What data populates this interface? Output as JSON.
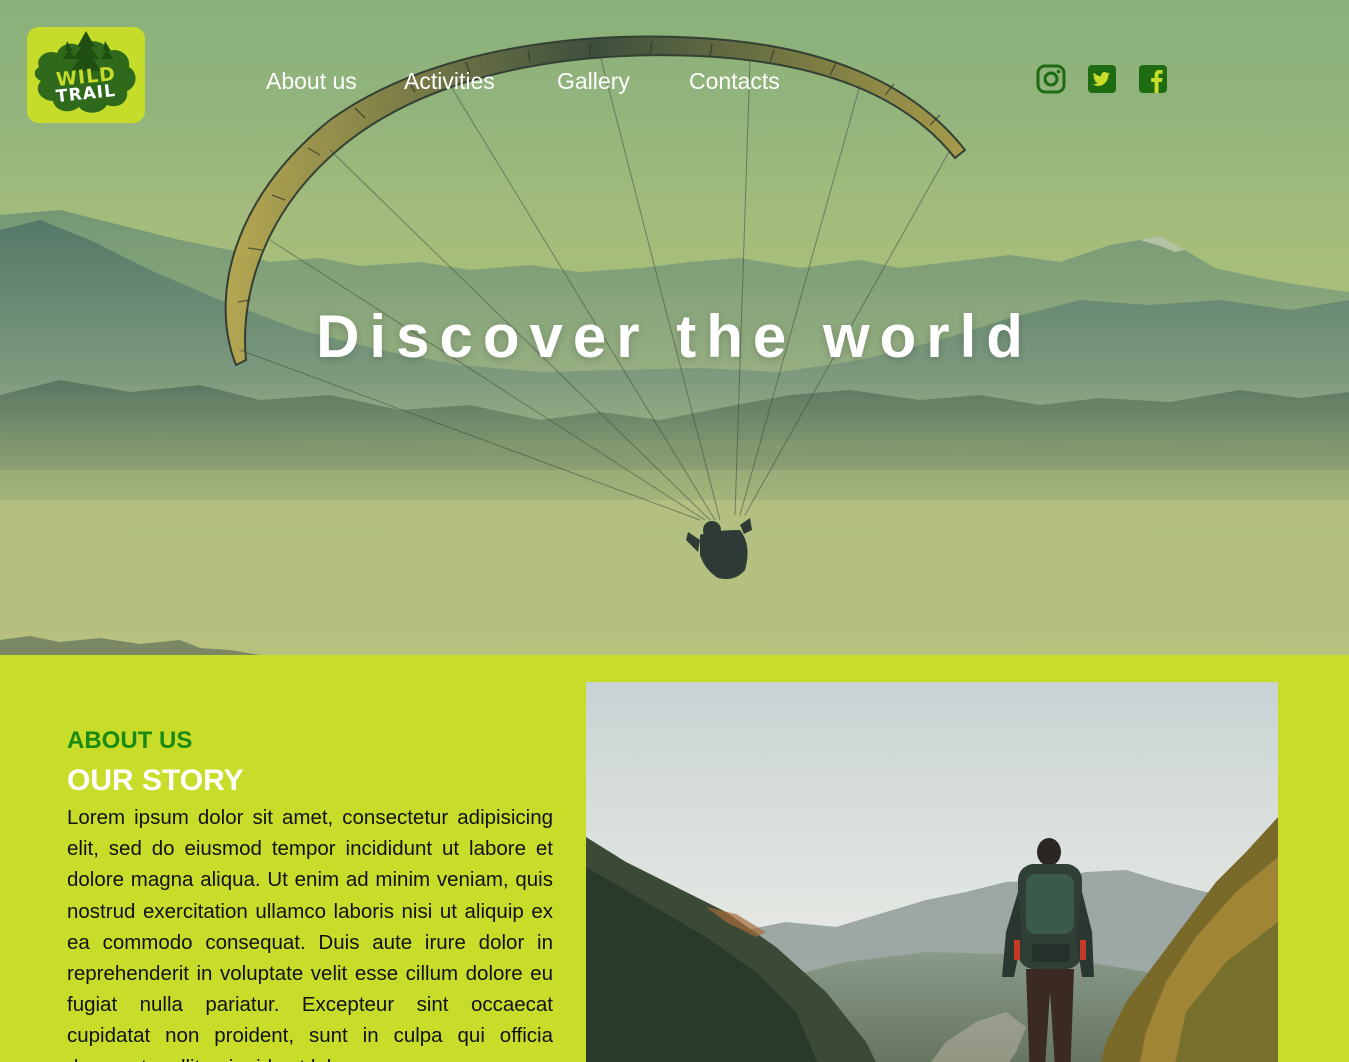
{
  "logo": {
    "line1": "WILD",
    "line2": "TRAIL"
  },
  "nav": {
    "items": [
      {
        "label": "About us"
      },
      {
        "label": "Activities"
      },
      {
        "label": "Gallery"
      },
      {
        "label": "Contacts"
      }
    ]
  },
  "social": {
    "icons": [
      "instagram-icon",
      "twitter-icon",
      "facebook-icon"
    ],
    "color": "#1e6b12"
  },
  "hero": {
    "title": "Discover the world"
  },
  "about": {
    "label": "ABOUT US",
    "heading": "OUR STORY",
    "body": "Lorem ipsum dolor sit amet, consectetur adipisicing elit, sed do eiusmod tempor incididunt ut labore et dolore magna aliqua. Ut enim ad minim veniam, quis nostrud exercitation ullamco laboris nisi ut aliquip ex ea commodo consequat. Duis aute irure dolor in reprehenderit in voluptate velit esse cillum dolore eu fugiat nulla pariatur. Excepteur sint occaecat cupidatat non proident, sunt in culpa qui officia deserunt mollit anim id est laborum."
  },
  "colors": {
    "accent_green": "#c8dd2a",
    "label_green": "#1a8a12",
    "icon_green": "#1e6b12"
  }
}
